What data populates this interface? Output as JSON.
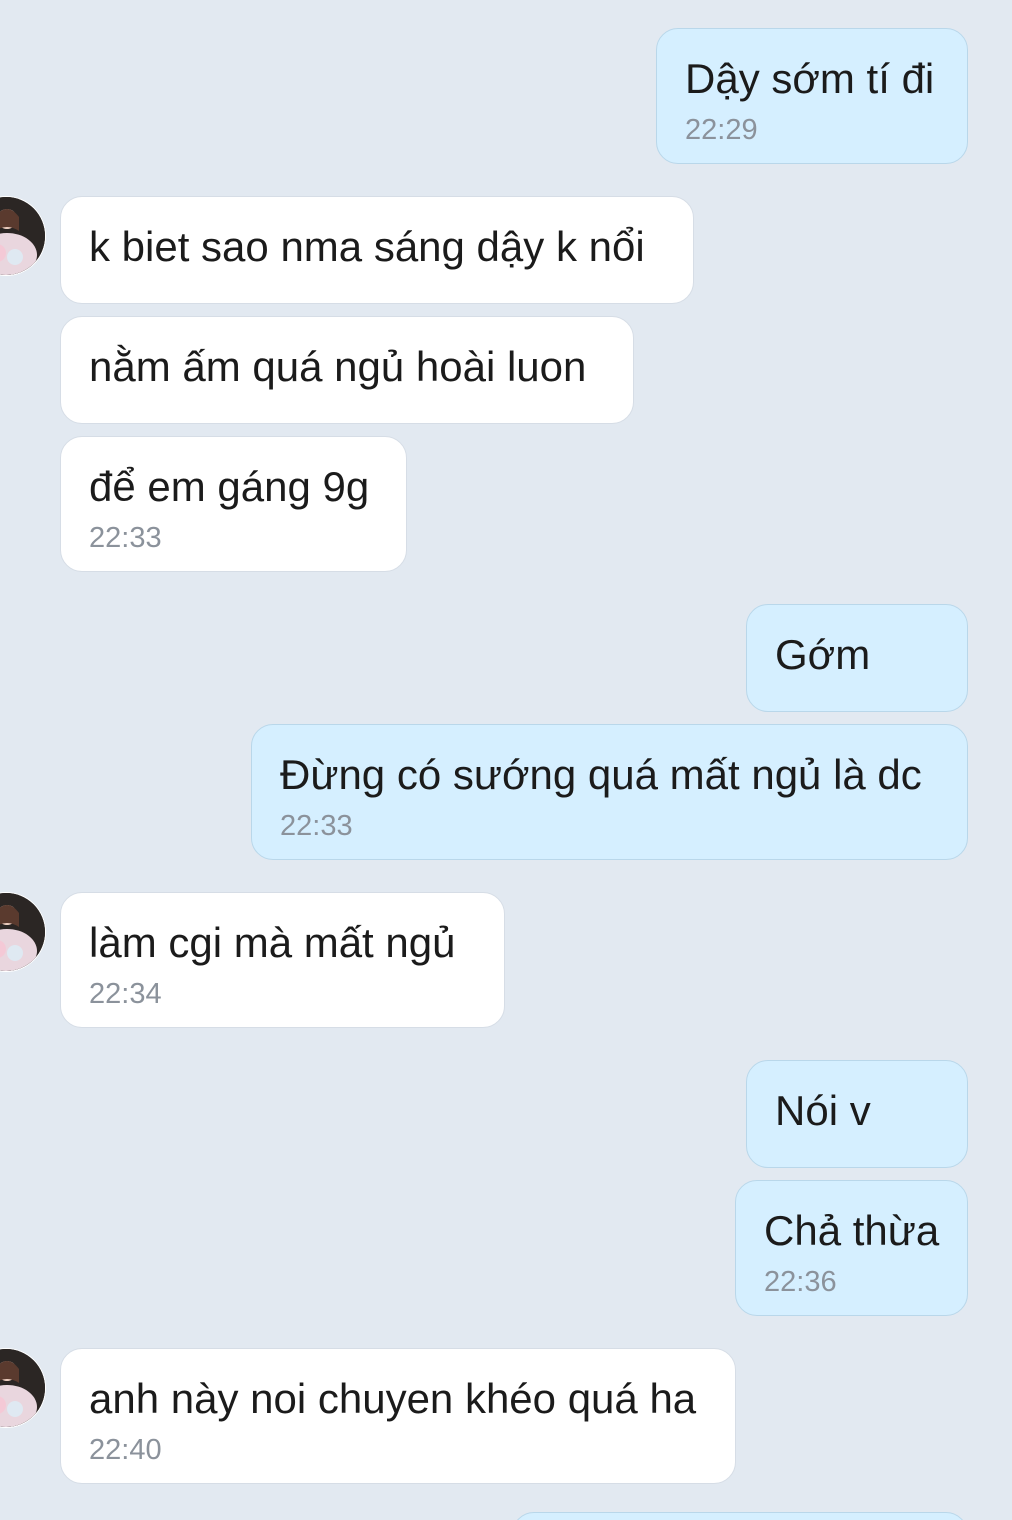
{
  "messages": [
    {
      "text": "Dậy sớm tí đi",
      "time": "22:29"
    },
    {
      "text": "k biet sao nma sáng dậy k nổi"
    },
    {
      "text": "nằm ấm quá ngủ hoài luon"
    },
    {
      "text": "để em gáng 9g",
      "time": "22:33"
    },
    {
      "text": "Gớm"
    },
    {
      "text": "Đừng có sướng quá mất ngủ là dc",
      "time": "22:33"
    },
    {
      "text": "làm cgi mà mất ngủ",
      "time": "22:34"
    },
    {
      "text": "Nói v"
    },
    {
      "text": "Chả thừa",
      "time": "22:36"
    },
    {
      "text": "anh này noi chuyen khéo quá ha",
      "time": "22:40"
    }
  ],
  "colors": {
    "background": "#e2e9f1",
    "incoming_bubble": "#ffffff",
    "outgoing_bubble": "#d5efff",
    "time_text": "#8b929b"
  }
}
